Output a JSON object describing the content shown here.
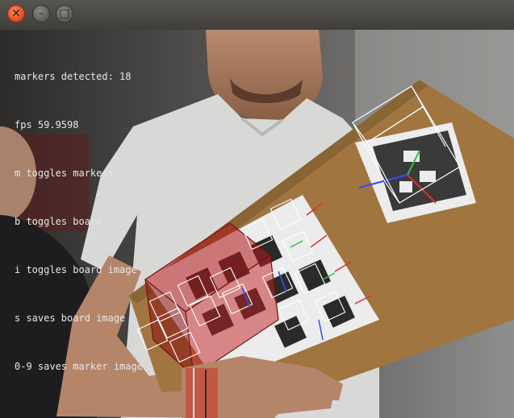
{
  "window": {
    "close_icon": "✕",
    "minimize_icon": "–",
    "maximize_icon": "□"
  },
  "overlay": {
    "lines": [
      "markers detected: 18",
      "fps 59.9598",
      "m toggles markers",
      "b toggles board",
      "i toggles board image",
      "s saves board image",
      "0-9 saves marker image"
    ]
  },
  "colors": {
    "accent_close": "#df4a1d",
    "axis_x": "#e03030",
    "axis_y": "#30c040",
    "axis_z": "#3050ff",
    "cube_fill": "#b01818",
    "wireframe": "#ffffff"
  }
}
